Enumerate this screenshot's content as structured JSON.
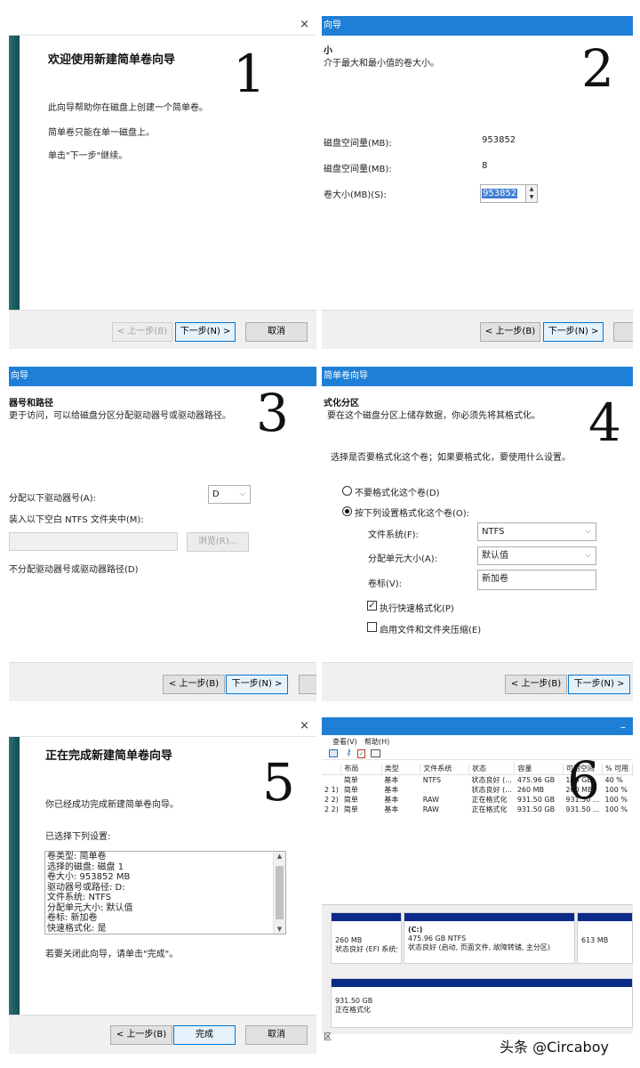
{
  "labels": [
    "1",
    "2",
    "3",
    "4",
    "5",
    "6"
  ],
  "common": {
    "close_glyph": "×",
    "prev": "< 上一步(B)",
    "next": "下一步(N) >",
    "cancel": "取消",
    "finish": "完成"
  },
  "p1": {
    "title": "欢迎使用新建简单卷向导",
    "lines": [
      "此向导帮助你在磁盘上创建一个简单卷。",
      "简单卷只能在单一磁盘上。",
      "单击\"下一步\"继续。"
    ]
  },
  "p2": {
    "titlebar": "向导",
    "heading": "小",
    "desc": "介于最大和最小值的卷大小。",
    "rows": [
      {
        "label": "磁盘空间量(MB):",
        "value": "953852"
      },
      {
        "label": "磁盘空间量(MB):",
        "value": "8"
      }
    ],
    "size_label": "卷大小(MB)(S):",
    "size_value": "953852"
  },
  "p3": {
    "titlebar": "向导",
    "heading": "器号和路径",
    "desc": "更于访问，可以给磁盘分区分配驱动器号或驱动器路径。",
    "opt1": "分配以下驱动器号(A):",
    "drive_letter": "D",
    "opt2": "装入以下空白 NTFS 文件夹中(M):",
    "browse": "浏览(R)...",
    "opt3": "不分配驱动器号或驱动器路径(D)"
  },
  "p4": {
    "titlebar": "简单卷向导",
    "heading": "式化分区",
    "desc": "要在这个磁盘分区上储存数据，你必须先将其格式化。",
    "question": "选择是否要格式化这个卷；如果要格式化，要使用什么设置。",
    "radio_no": "不要格式化这个卷(D)",
    "radio_yes": "按下列设置格式化这个卷(O):",
    "fs_label": "文件系统(F):",
    "fs_value": "NTFS",
    "alloc_label": "分配单元大小(A):",
    "alloc_value": "默认值",
    "vol_label": "卷标(V):",
    "vol_value": "新加卷",
    "quick_format": "执行快速格式化(P)",
    "compress": "启用文件和文件夹压缩(E)"
  },
  "p5": {
    "title": "正在完成新建简单卷向导",
    "done": "你已经成功完成新建简单卷向导。",
    "selected_label": "已选择下列设置:",
    "settings": [
      "卷类型: 简单卷",
      "选择的磁盘: 磁盘 1",
      "卷大小: 953852 MB",
      "驱动器号或路径: D:",
      "文件系统: NTFS",
      "分配单元大小: 默认值",
      "卷标: 新加卷",
      "快速格式化: 是"
    ],
    "close_hint": "若要关闭此向导，请单击\"完成\"。"
  },
  "p6": {
    "minimize": "–",
    "menu": [
      "查看(V)",
      "帮助(H)"
    ],
    "columns": [
      "布局",
      "类型",
      "文件系统",
      "状态",
      "容量",
      "可用空间",
      "% 可用"
    ],
    "rows": [
      {
        "vol": "",
        "layout": "简单",
        "type": "基本",
        "fs": "NTFS",
        "status": "状态良好 (...",
        "cap": "475.96 GB",
        "free": "190 GB",
        "pct": "40 %"
      },
      {
        "vol": "2 1)",
        "layout": "简单",
        "type": "基本",
        "fs": "",
        "status": "状态良好 (...",
        "cap": "260 MB",
        "free": "260 MB",
        "pct": "100 %"
      },
      {
        "vol": "2 2)",
        "layout": "简单",
        "type": "基本",
        "fs": "RAW",
        "status": "正在格式化",
        "cap": "931.50 GB",
        "free": "931.50 ...",
        "pct": "100 %"
      },
      {
        "vol": "2 2)",
        "layout": "简单",
        "type": "基本",
        "fs": "RAW",
        "status": "正在格式化",
        "cap": "931.50 GB",
        "free": "931.50 ...",
        "pct": "100 %"
      }
    ],
    "disk0": {
      "efi_size": "260 MB",
      "efi_status": "状态良好 (EFI 系统分区)",
      "c_name": "(C:)",
      "c_size": "475.96 GB NTFS",
      "c_status": "状态良好 (启动, 页面文件, 故障转储, 主分区)",
      "rec_size": "613 MB"
    },
    "disk1": {
      "size": "931.50 GB",
      "status": "正在格式化"
    },
    "footer_text": "区"
  },
  "watermark": "头条 @Circaboy"
}
